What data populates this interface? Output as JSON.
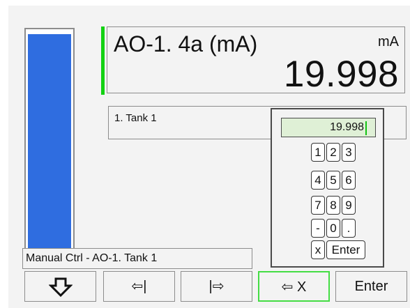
{
  "level": {
    "value": 19.998,
    "fill_fraction": 0.98,
    "color": "#2f6de0"
  },
  "reading": {
    "title": "AO-1. 4a (mA)",
    "unit": "mA",
    "value": "19.998",
    "marker_color": "#12d212"
  },
  "description": "1. Tank 1",
  "keypad": {
    "display_value": "19.998",
    "keys": [
      "1",
      "2",
      "3",
      "4",
      "5",
      "6",
      "7",
      "8",
      "9",
      "-",
      "0",
      ".",
      "x",
      "Enter"
    ]
  },
  "status": "Manual Ctrl - AO-1. Tank 1",
  "toolbar": {
    "left_label": "⇦|",
    "right_label": "|⇨",
    "clear_label": "⇦ X",
    "enter_label": "Enter"
  },
  "icons": {
    "down": "down-arrow-icon"
  },
  "colors": {
    "active_border": "#44dd44",
    "display_bg": "#dff0d6"
  }
}
